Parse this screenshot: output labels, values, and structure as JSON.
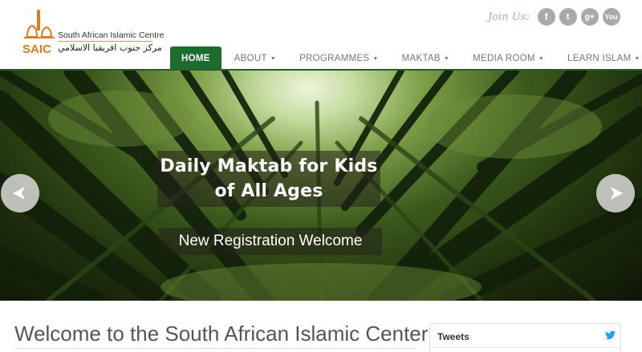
{
  "brand": {
    "name_en": "South African Islamic Centre",
    "name_ar": "مركز جنوب افريقيا الاسلامي",
    "logo_initials": "SAIC"
  },
  "social": {
    "label": "Join Us:",
    "items": [
      {
        "name": "facebook-icon",
        "glyph": "f"
      },
      {
        "name": "twitter-icon",
        "glyph": "t"
      },
      {
        "name": "google-plus-icon",
        "glyph": "g+"
      },
      {
        "name": "youtube-icon",
        "glyph": "You"
      }
    ]
  },
  "nav": {
    "items": [
      {
        "label": "HOME",
        "active": true
      },
      {
        "label": "ABOUT",
        "dropdown": true
      },
      {
        "label": "PROGRAMMES",
        "dropdown": true
      },
      {
        "label": "MAKTAB",
        "dropdown": true
      },
      {
        "label": "MEDIA ROOM",
        "dropdown": true
      },
      {
        "label": "LEARN ISLAM",
        "dropdown": true
      }
    ]
  },
  "hero": {
    "headline_line1": "Daily Maktab for Kids",
    "headline_line2": "of All Ages",
    "subline": "New Registration Welcome",
    "prev_icon": "arrow-left-icon",
    "next_icon": "arrow-right-icon"
  },
  "main": {
    "welcome_title": "Welcome to the South African Islamic Center"
  },
  "sidebar": {
    "tweets_title": "Tweets"
  },
  "colors": {
    "nav_active_bg": "#1e6b2e",
    "nav_text": "#777777",
    "social_icon_bg": "#a9a9a9",
    "logo_orange": "#e07a1f",
    "logo_gold": "#c8a04a",
    "twitter_blue": "#1da1f2"
  }
}
